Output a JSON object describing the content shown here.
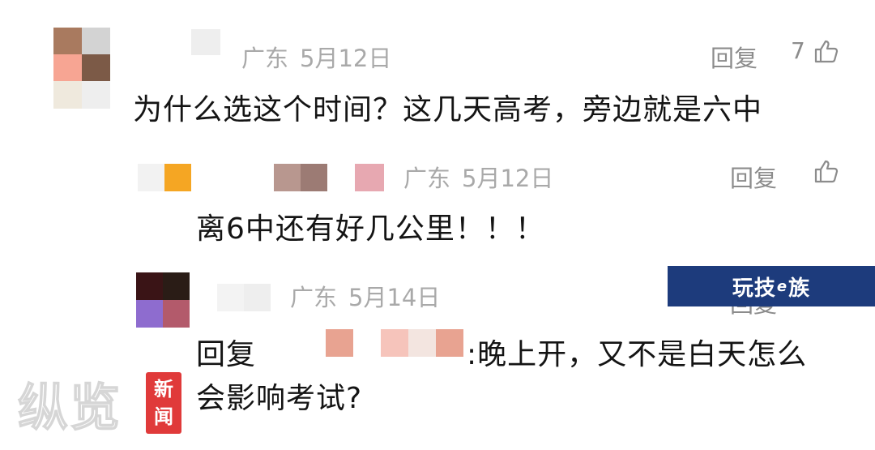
{
  "comments": [
    {
      "location": "广东",
      "date": "5月12日",
      "reply_label": "回复",
      "like_count": "7",
      "text": "为什么选这个时间？这几天高考，旁边就是六中"
    },
    {
      "location": "广东",
      "date": "5月12日",
      "reply_label": "回复",
      "like_count": "",
      "text": "离6中还有好几公里！！！"
    },
    {
      "location": "广东",
      "date": "5月14日",
      "reply_label": "回复",
      "reply_prefix": "回复",
      "text_tail": ":晚上开，又不是白天怎么",
      "text_line2": "会影响考试?"
    }
  ],
  "overlay_banner": {
    "part1": "玩技",
    "part2": "e",
    "part3": "族",
    "color": "#1d3b7c"
  },
  "watermark": {
    "text": "纵览",
    "badge_line1": "新",
    "badge_line2": "闻",
    "badge_color": "#e03a3a"
  }
}
